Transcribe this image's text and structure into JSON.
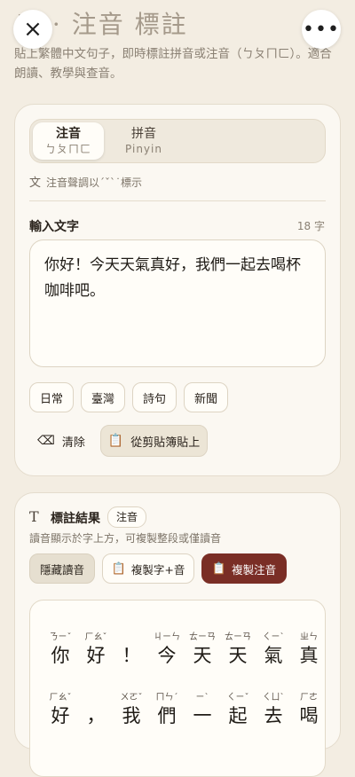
{
  "header": {
    "title": "音 · 注音 標註",
    "subtitle": "貼上繁體中文句子，即時標註拼音或注音（ㄅㄆㄇㄈ）。適合朗讀、教學與查音。",
    "close_icon": "×",
    "more_icon": "•••"
  },
  "mode": {
    "zhuyin_label": "注音",
    "zhuyin_sub": "ㄅㄆㄇㄈ",
    "pinyin_label": "拼音",
    "pinyin_sub": "Pinyin",
    "selected": "zhuyin"
  },
  "tone_hint": "注音聲調以ˊˇˋ˙標示",
  "input": {
    "label": "輸入文字",
    "char_count": "18 字",
    "text": "你好！今天天氣真好，我們一起去喝杯咖啡吧。"
  },
  "presets": [
    "日常",
    "臺灣",
    "詩句",
    "新聞"
  ],
  "actions": {
    "clear": "清除",
    "paste": "從剪貼簿貼上"
  },
  "result": {
    "title": "標註結果",
    "badge": "注音",
    "description": "讀音顯示於字上方，可複製整段或僅讀音",
    "hide_label": "隱藏讀音",
    "copy_both_label": "複製字+音",
    "copy_zhuyin_label": "複製注音",
    "rows": [
      [
        {
          "hz": "你",
          "zy": "ㄋㄧˇ"
        },
        {
          "hz": "好",
          "zy": "ㄏㄠˇ"
        },
        {
          "hz": "！",
          "zy": ""
        },
        {
          "hz": "今",
          "zy": "ㄐㄧㄣ"
        },
        {
          "hz": "天",
          "zy": "ㄊㄧㄢ"
        },
        {
          "hz": "天",
          "zy": "ㄊㄧㄢ"
        },
        {
          "hz": "氣",
          "zy": "ㄑㄧˋ"
        },
        {
          "hz": "真",
          "zy": "ㄓㄣ"
        }
      ],
      [
        {
          "hz": "好",
          "zy": "ㄏㄠˇ"
        },
        {
          "hz": "，",
          "zy": ""
        },
        {
          "hz": "我",
          "zy": "ㄨㄛˇ"
        },
        {
          "hz": "們",
          "zy": "ㄇㄣˊ"
        },
        {
          "hz": "一",
          "zy": "ㄧˋ"
        },
        {
          "hz": "起",
          "zy": "ㄑㄧˇ"
        },
        {
          "hz": "去",
          "zy": "ㄑㄩˋ"
        },
        {
          "hz": "喝",
          "zy": "ㄏㄜ"
        }
      ]
    ]
  },
  "colors": {
    "accent": "#7a2e26",
    "background": "#f3ede2",
    "card": "#fbf8f2"
  }
}
